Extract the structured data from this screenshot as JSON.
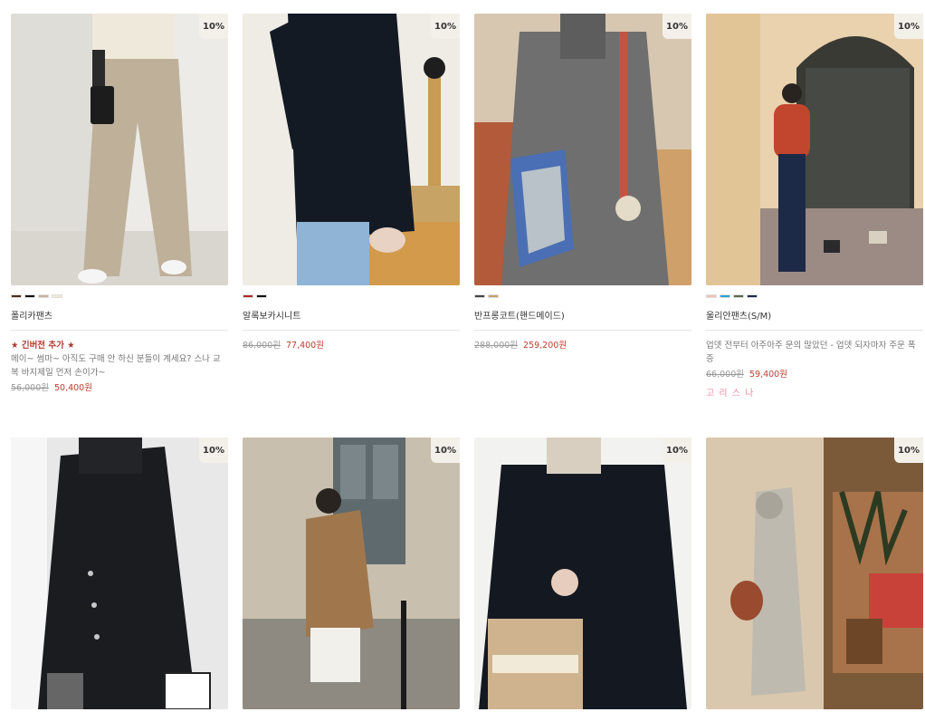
{
  "products": [
    {
      "name": "폴리카팬츠",
      "discount": "10%",
      "tag": "★ 긴버전 추가 ★",
      "desc": "메이~ 썸마~ 아직도 구매 안 하신 분들이 계세요? 스나 교복 바지제일 먼저 손이가~",
      "orig_price": "56,000원",
      "sale_price": "50,400원",
      "brand": "",
      "swatches": [
        "#4a2d1c",
        "#111111",
        "#c9b39b",
        "#f1ead8"
      ]
    },
    {
      "name": "알록보카시니트",
      "discount": "10%",
      "tag": "",
      "desc": "",
      "orig_price": "86,000원",
      "sale_price": "77,400원",
      "brand": "",
      "swatches": [
        "#b3282d",
        "#111111"
      ]
    },
    {
      "name": "반프롱코트(핸드메이드)",
      "discount": "10%",
      "tag": "",
      "desc": "",
      "orig_price": "288,000원",
      "sale_price": "259,200원",
      "brand": "",
      "swatches": [
        "#444444",
        "#c8a06a"
      ]
    },
    {
      "name": "울리안팬츠(S/M)",
      "discount": "10%",
      "tag": "",
      "desc": "업뎃 전부터 아주아주 문의 많았던 - 업뎃 되자마자 주문 폭증",
      "orig_price": "66,000원",
      "sale_price": "59,400원",
      "brand": "고 리 스 나",
      "swatches": [
        "#f2c1b8",
        "#2ba4d9",
        "#5a6a4a",
        "#1f2a4a"
      ]
    },
    {
      "name": "",
      "discount": "10%",
      "tag": "",
      "desc": "",
      "orig_price": "",
      "sale_price": "",
      "brand": "",
      "swatches": []
    },
    {
      "name": "",
      "discount": "10%",
      "tag": "",
      "desc": "",
      "orig_price": "",
      "sale_price": "",
      "brand": "",
      "swatches": []
    },
    {
      "name": "",
      "discount": "10%",
      "tag": "",
      "desc": "",
      "orig_price": "",
      "sale_price": "",
      "brand": "",
      "swatches": []
    },
    {
      "name": "",
      "discount": "10%",
      "tag": "",
      "desc": "",
      "orig_price": "",
      "sale_price": "",
      "brand": "",
      "swatches": []
    }
  ]
}
